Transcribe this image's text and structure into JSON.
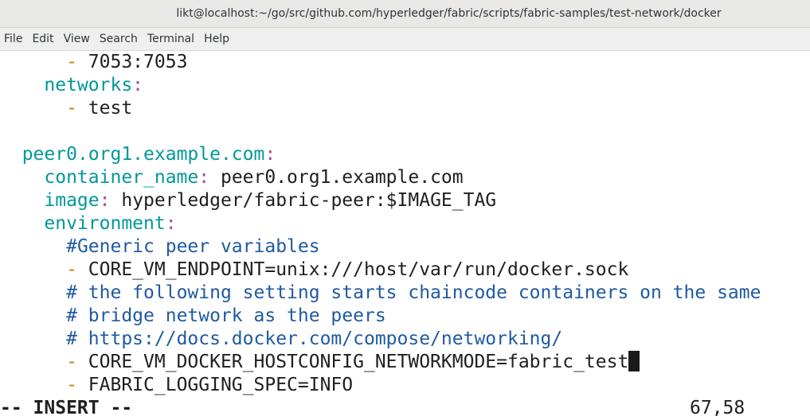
{
  "window": {
    "title": "likt@localhost:~/go/src/github.com/hyperledger/fabric/scripts/fabric-samples/test-network/docker"
  },
  "menu": [
    "File",
    "Edit",
    "View",
    "Search",
    "Terminal",
    "Help"
  ],
  "editor": {
    "lines": [
      {
        "indent": "      ",
        "dash": "- ",
        "text": "7053:7053"
      },
      {
        "indent": "    ",
        "key": "networks",
        "colon": ":"
      },
      {
        "indent": "      ",
        "dash": "- ",
        "text": "test"
      },
      {
        "indent": "  ",
        "key": "peer0.org1.example.com",
        "colon": ":"
      },
      {
        "indent": "    ",
        "key": "container_name",
        "colon": ":",
        "value": " peer0.org1.example.com"
      },
      {
        "indent": "    ",
        "key": "image",
        "colon": ":",
        "value": " hyperledger/fabric-peer:$IMAGE_TAG"
      },
      {
        "indent": "    ",
        "key": "environment",
        "colon": ":"
      },
      {
        "indent": "      ",
        "comment": "#Generic peer variables"
      },
      {
        "indent": "      ",
        "dash": "- ",
        "text": "CORE_VM_ENDPOINT=unix:///host/var/run/docker.sock"
      },
      {
        "indent": "      ",
        "comment": "# the following setting starts chaincode containers on the same"
      },
      {
        "indent": "      ",
        "comment": "# bridge network as the peers"
      },
      {
        "indent": "      ",
        "comment": "# https://docs.docker.com/compose/networking/"
      },
      {
        "indent": "      ",
        "dash": "- ",
        "text": "CORE_VM_DOCKER_HOSTCONFIG_NETWORKMODE=fabric_test"
      },
      {
        "indent": "      ",
        "dash": "- ",
        "text": "FABRIC_LOGGING_SPEC=INFO"
      }
    ]
  },
  "status": {
    "mode": "-- INSERT --",
    "position": "67,58"
  },
  "colors": {
    "key": "#03979a",
    "colon": "#a04ea4",
    "dash": "#b8860b",
    "comment": "#1f5aa0"
  }
}
